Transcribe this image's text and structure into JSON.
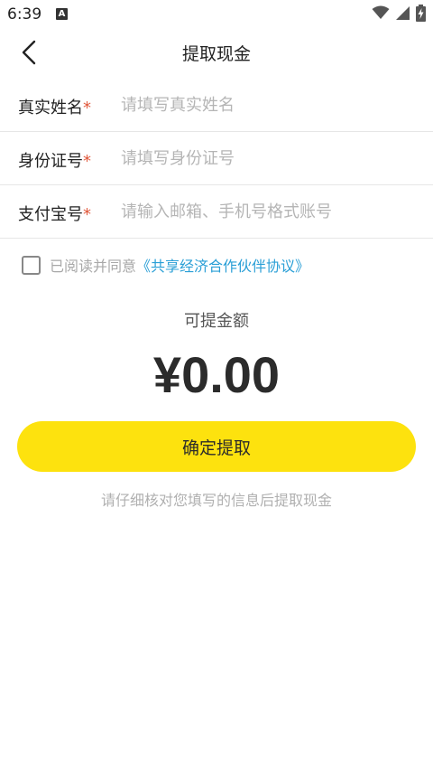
{
  "status_bar": {
    "time": "6:39",
    "notification_icon_letter": "A",
    "icons": [
      "wifi-icon",
      "signal-icon",
      "battery-charging-icon"
    ]
  },
  "nav": {
    "title": "提取现金",
    "back_icon": "chevron-left-icon"
  },
  "form": {
    "required_mark": "*",
    "fields": [
      {
        "label": "真实姓名",
        "placeholder": "请填写真实姓名",
        "value": ""
      },
      {
        "label": "身份证号",
        "placeholder": "请填写身份证号",
        "value": ""
      },
      {
        "label": "支付宝号",
        "placeholder": "请输入邮箱、手机号格式账号",
        "value": ""
      }
    ]
  },
  "agreement": {
    "checked": false,
    "prefix": "已阅读并同意",
    "link": "《共享经济合作伙伴协议》"
  },
  "balance": {
    "label": "可提金额",
    "amount": "¥0.00"
  },
  "confirm_button": {
    "label": "确定提取"
  },
  "hint": "请仔细核对您填写的信息后提取现金",
  "colors": {
    "accent_yellow": "#fde20e",
    "link_blue": "#2a9fd6",
    "required_red": "#e0573a",
    "placeholder_gray": "#b5b5b5"
  }
}
